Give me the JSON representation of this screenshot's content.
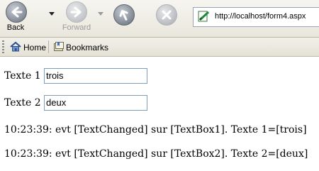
{
  "toolbar": {
    "back_label": "Back",
    "forward_label": "Forward",
    "url": "http://localhost/form4.aspx"
  },
  "bookmarks_bar": {
    "home_label": "Home",
    "bookmarks_label": "Bookmarks"
  },
  "form": {
    "label1": "Texte 1 :",
    "value1": "trois",
    "label2": "Texte 2 :",
    "value2": "deux"
  },
  "log": [
    "10:23:39: evt [TextChanged] sur [TextBox1]. Texte 1=[trois]",
    "10:23:39: evt [TextChanged] sur [TextBox2]. Texte 2=[deux]"
  ],
  "icons": {
    "back": "back-arrow-icon",
    "forward": "forward-arrow-icon",
    "reload": "reload-icon",
    "stop": "stop-icon",
    "home": "home-icon",
    "bookmarks": "bookmarks-icon",
    "page": "page-icon"
  }
}
